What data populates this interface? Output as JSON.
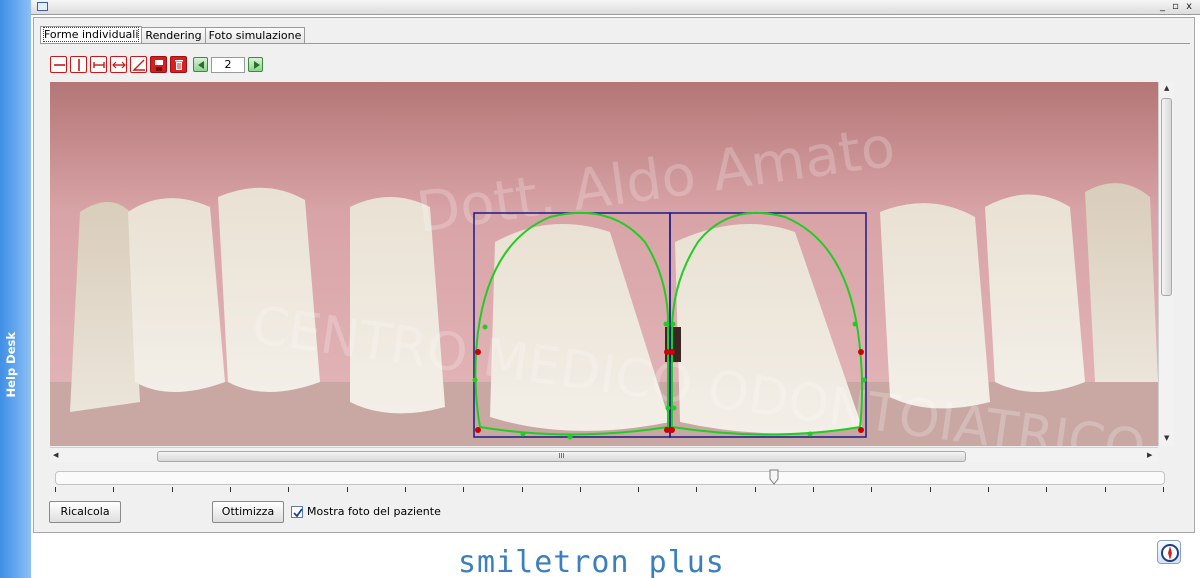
{
  "sidebar": {
    "help_label": "Help Desk"
  },
  "window": {
    "controls": "_ ▫ x"
  },
  "tabs": [
    {
      "label": "Forme individuali",
      "active": true
    },
    {
      "label": "Rendering",
      "active": false
    },
    {
      "label": "Foto simulazione",
      "active": false
    }
  ],
  "toolbar": {
    "tools": [
      "horizontal-line-icon",
      "vertical-line-icon",
      "width-measure-icon",
      "distance-arrows-icon",
      "angle-icon",
      "save-icon",
      "delete-icon"
    ],
    "page_number": "2",
    "prev_icon": "triangle-left-icon",
    "next_icon": "triangle-right-icon"
  },
  "viewport": {
    "watermark_line1": "Dott. Aldo Amato",
    "watermark_line2": "CENTRO MEDICO ODONTOIATRICO",
    "shapes_color": "#22cc22",
    "boxes_color": "#1a1a8a",
    "control_point_color": "#cc0000"
  },
  "scrollbars": {
    "h_label": "III",
    "v_label": "III"
  },
  "buttons": {
    "recalc_label": "Ricalcola",
    "optimize_label": "Ottimizza"
  },
  "checkbox": {
    "label": "Mostra foto del paziente",
    "checked": true
  },
  "footer": {
    "brand": "smiletron plus"
  },
  "colors": {
    "accent": "#3b7fbf",
    "sidebar": "#4a94e8"
  }
}
